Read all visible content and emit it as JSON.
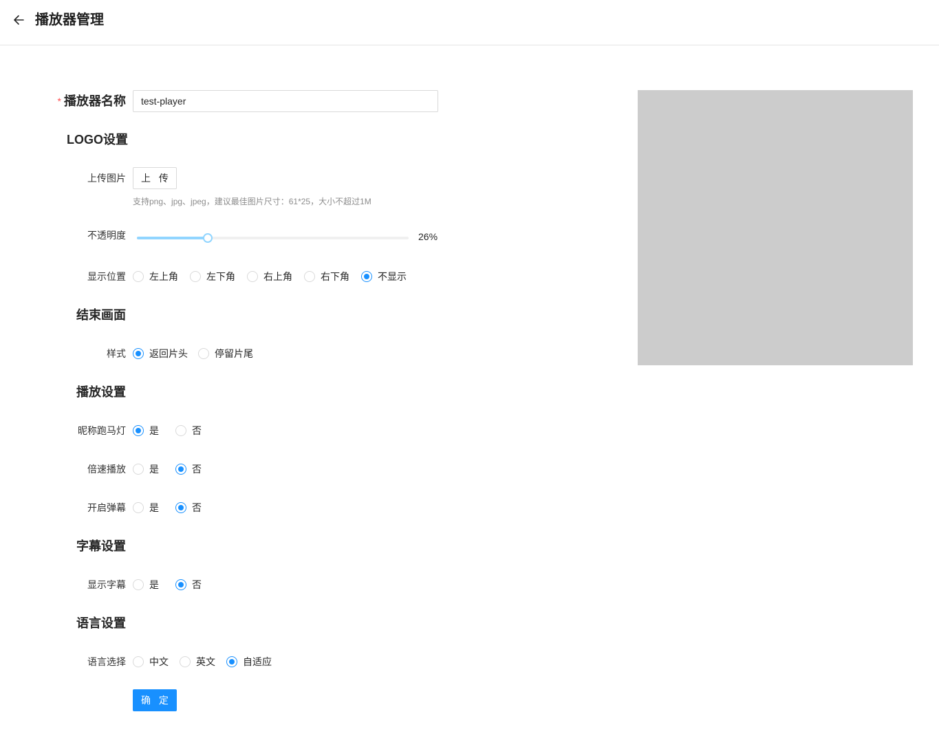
{
  "header": {
    "title": "播放器管理"
  },
  "form": {
    "name": {
      "required_mark": "*",
      "label": "播放器名称",
      "value": "test-player"
    },
    "logo_section": "LOGO设置",
    "upload": {
      "label": "上传图片",
      "button": "上 传",
      "hint": "支持png、jpg、jpeg，建议最佳图片尺寸：61*25，大小不超过1M"
    },
    "opacity": {
      "label": "不透明度",
      "value_percent": 26,
      "value_text": "26%"
    },
    "position": {
      "label": "显示位置",
      "options": [
        "左上角",
        "左下角",
        "右上角",
        "右下角",
        "不显示"
      ],
      "selected": "不显示"
    },
    "end_section": "结束画面",
    "end_style": {
      "label": "样式",
      "options": [
        "返回片头",
        "停留片尾"
      ],
      "selected": "返回片头"
    },
    "play_section": "播放设置",
    "marquee": {
      "label": "昵称跑马灯",
      "options": [
        "是",
        "否"
      ],
      "selected": "是"
    },
    "speed": {
      "label": "倍速播放",
      "options": [
        "是",
        "否"
      ],
      "selected": "否"
    },
    "danmaku": {
      "label": "开启弹幕",
      "options": [
        "是",
        "否"
      ],
      "selected": "否"
    },
    "subtitle_section": "字幕设置",
    "subtitle": {
      "label": "显示字幕",
      "options": [
        "是",
        "否"
      ],
      "selected": "否"
    },
    "language_section": "语言设置",
    "language": {
      "label": "语言选择",
      "options": [
        "中文",
        "英文",
        "自适应"
      ],
      "selected": "自适应"
    },
    "submit": "确 定"
  },
  "colors": {
    "primary": "#1890ff",
    "slider": "#91d5ff",
    "preview_bg": "#cccccc",
    "required": "#ff4d4f"
  }
}
